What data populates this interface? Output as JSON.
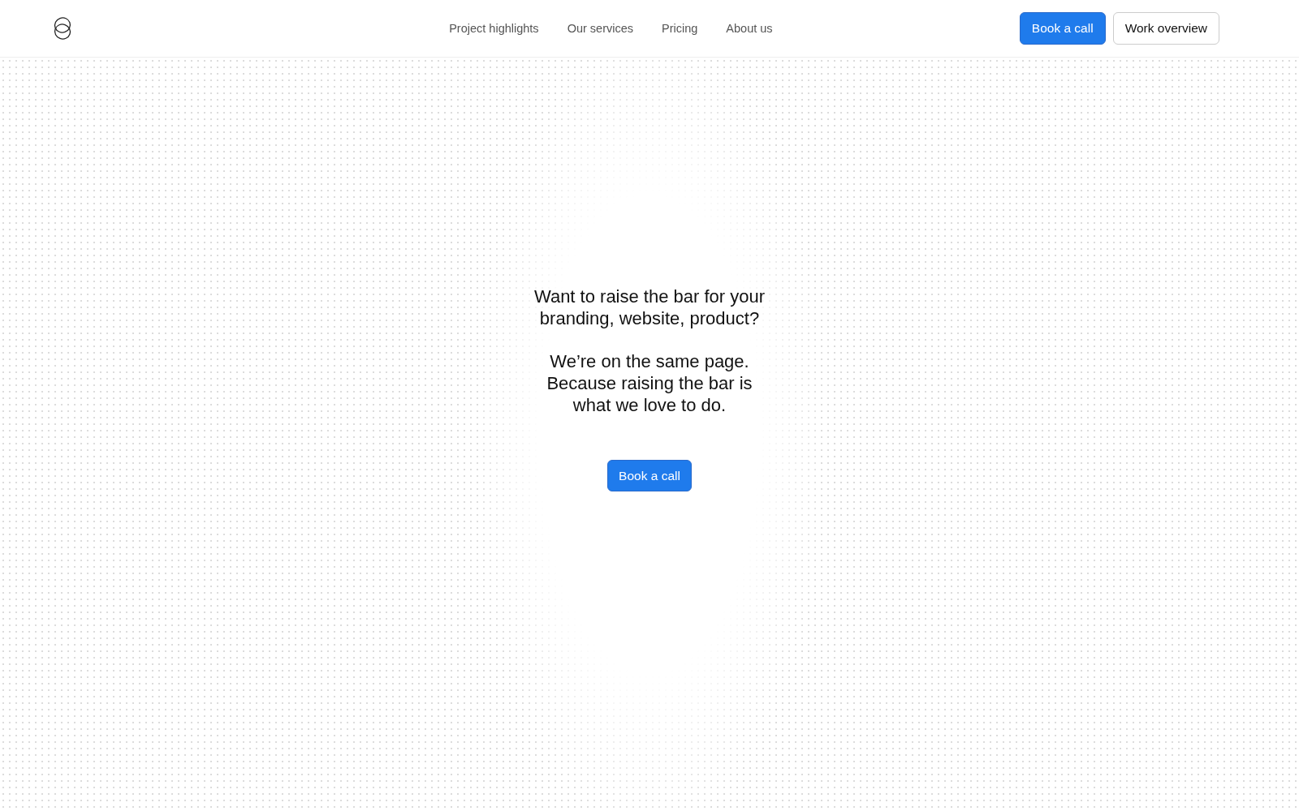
{
  "nav": {
    "links": [
      {
        "label": "Project highlights"
      },
      {
        "label": "Our services"
      },
      {
        "label": "Pricing"
      },
      {
        "label": "About us"
      }
    ],
    "actions": [
      {
        "label": "Book a call",
        "kind": "primary"
      },
      {
        "label": "Work overview",
        "kind": "secondary"
      }
    ]
  },
  "hero": {
    "paragraphs": [
      "Want to raise the bar for your branding, website, product?",
      "We’re on the same page. Because raising the bar is what we love to do."
    ],
    "button": {
      "label": "Book a call",
      "kind": "primary"
    }
  }
}
